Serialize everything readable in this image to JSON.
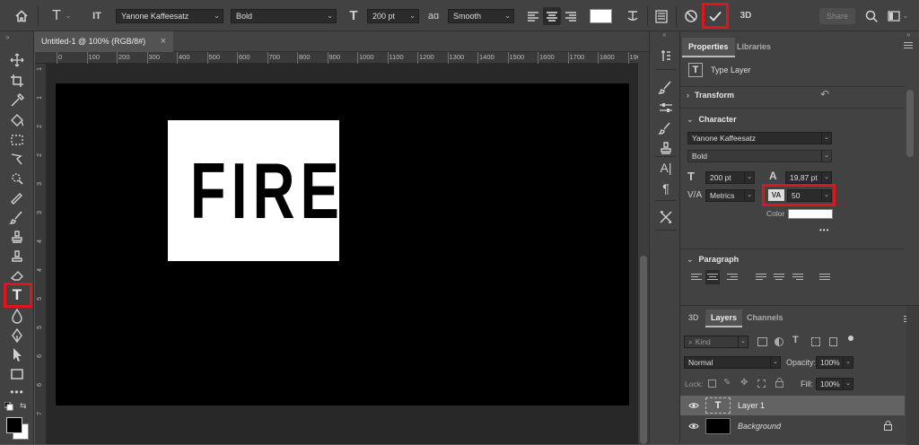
{
  "options_bar": {
    "font_family": "Yanone Kaffeesatz",
    "font_style": "Bold",
    "font_size": "200 pt",
    "aa_icon": "aɑ",
    "anti_alias": "Smooth",
    "type_icon": "T",
    "orientation_icon": "IT",
    "size_icon": "T",
    "three_d": "3D",
    "share": "Share",
    "text_color": "#ffffff"
  },
  "document": {
    "tab_title": "Untitled-1 @ 100% (RGB/8#)",
    "close": "×",
    "ruler_ticks": [
      "0",
      "100",
      "200",
      "300",
      "400",
      "500",
      "600",
      "700",
      "800",
      "900",
      "1000",
      "1100",
      "1200",
      "1300",
      "1400",
      "1500",
      "1600",
      "1700",
      "1800",
      "1900"
    ],
    "vruler_ticks": [
      "1",
      "1",
      "2",
      "2",
      "3",
      "3",
      "4",
      "4",
      "5",
      "5",
      "6",
      "6",
      "7"
    ],
    "canvas_text": "FIRE",
    "canvas_bg": "#000000",
    "text_box_bg": "#ffffff"
  },
  "properties": {
    "tab_properties": "Properties",
    "tab_libraries": "Libraries",
    "layer_type": "Type Layer",
    "layer_type_icon": "T",
    "transform": "Transform",
    "character": "Character",
    "font_family": "Yanone Kaffeesatz",
    "font_style": "Bold",
    "font_size": "200 pt",
    "leading": "19,87 pt",
    "kerning": "Metrics",
    "tracking": "50",
    "tracking_icon": "VA",
    "color_label": "Color",
    "color_value": "#ffffff",
    "more": "•••",
    "paragraph": "Paragraph",
    "size_icon": "T",
    "leading_icon": "A",
    "kerning_icon": "V/A"
  },
  "layers": {
    "tab_3d": "3D",
    "tab_layers": "Layers",
    "tab_channels": "Channels",
    "kind": "Kind",
    "blend_mode": "Normal",
    "opacity_label": "Opacity:",
    "opacity_value": "100%",
    "lock_label": "Lock:",
    "fill_label": "Fill:",
    "fill_value": "100%",
    "items": [
      {
        "name": "Layer 1",
        "thumb_icon": "T"
      },
      {
        "name": "Background"
      }
    ]
  },
  "colors": {
    "highlight": "#e0141e",
    "panel_bg": "#424242",
    "workspace_bg": "#282828"
  }
}
